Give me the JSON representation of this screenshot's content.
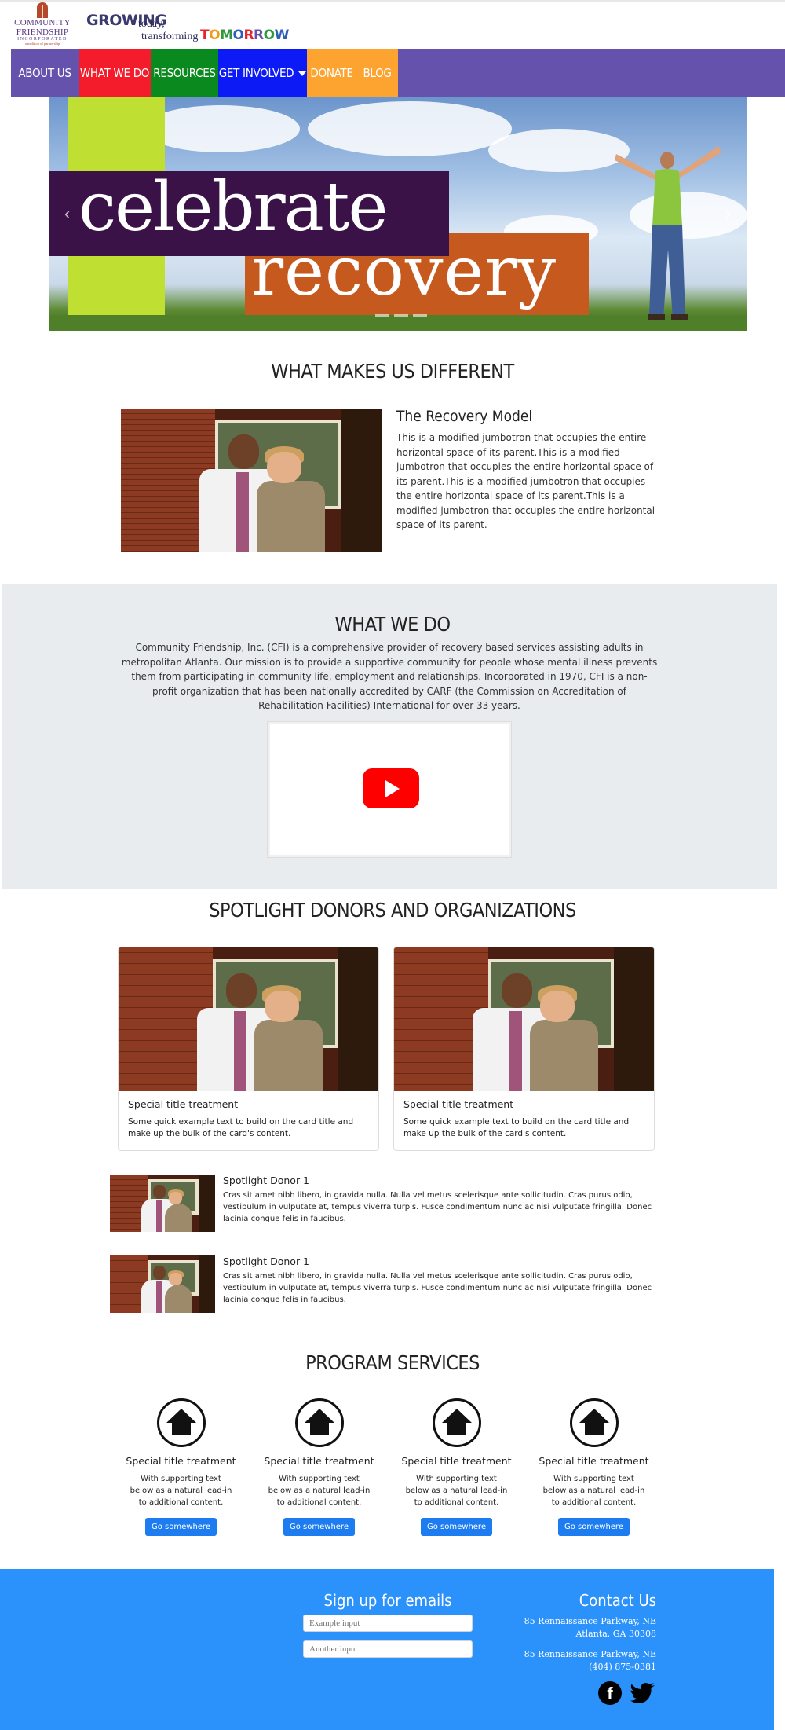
{
  "header": {
    "logo": {
      "line1": "COMMUNITY",
      "line2": "FRIENDSHIP",
      "line3": "INCORPORATED",
      "line4": "a tradition of partnership"
    },
    "tagline": {
      "growing": "GROWING",
      "today": "today,",
      "transforming": "transforming",
      "tomorrow": "TOMORROW"
    }
  },
  "nav": {
    "items": [
      {
        "label": "ABOUT US",
        "color": "#6452ad"
      },
      {
        "label": "WHAT WE DO",
        "color": "#f41c2b"
      },
      {
        "label": "RESOURCES",
        "color": "#0a8a1e"
      },
      {
        "label": "GET INVOLVED",
        "color": "#0c1bf6"
      },
      {
        "label": "DONATE",
        "color": "#fca330"
      },
      {
        "label": "BLOG",
        "color": "#fca330"
      }
    ]
  },
  "hero": {
    "word1": "celebrate",
    "word2": "recovery",
    "prev": "‹",
    "next": "›"
  },
  "different": {
    "heading": "WHAT MAKES US DIFFERENT",
    "title": "The Recovery Model",
    "text": "This is a modified jumbotron that occupies the entire horizontal space of its parent.This is a modified jumbotron that occupies the entire horizontal space of its parent.This is a modified jumbotron that occupies the entire horizontal space of its parent.This is a modified jumbotron that occupies the entire horizontal space of its parent."
  },
  "what_we_do": {
    "heading": "WHAT WE DO",
    "text": "Community Friendship, Inc. (CFI) is a comprehensive provider of recovery based services assisting adults in metropolitan Atlanta. Our mission is to provide a supportive community for people whose mental illness prevents them from participating in community life, employment and relationships. Incorporated in 1970, CFI is a non-profit organization that has been nationally accredited by CARF (the Commission on Accreditation of Rehabilitation Facilities) International for over 33 years."
  },
  "spotlight": {
    "heading": "SPOTLIGHT DONORS AND ORGANIZATIONS",
    "cards": [
      {
        "title": "Special title treatment",
        "text": "Some quick example text to build on the card title and make up the bulk of the card's content."
      },
      {
        "title": "Special title treatment",
        "text": "Some quick example text to build on the card title and make up the bulk of the card's content."
      }
    ],
    "donors": [
      {
        "title": "Spotlight Donor 1",
        "text": "Cras sit amet nibh libero, in gravida nulla. Nulla vel metus scelerisque ante sollicitudin. Cras purus odio, vestibulum in vulputate at, tempus viverra turpis. Fusce condimentum nunc ac nisi vulputate fringilla. Donec lacinia congue felis in faucibus."
      },
      {
        "title": "Spotlight Donor 1",
        "text": "Cras sit amet nibh libero, in gravida nulla. Nulla vel metus scelerisque ante sollicitudin. Cras purus odio, vestibulum in vulputate at, tempus viverra turpis. Fusce condimentum nunc ac nisi vulputate fringilla. Donec lacinia congue felis in faucibus."
      }
    ]
  },
  "services": {
    "heading": "PROGRAM SERVICES",
    "items": [
      {
        "icon": "home-icon",
        "title": "Special title treatment",
        "text": "With supporting text below as a natural lead-in to additional content.",
        "button": "Go somewhere"
      },
      {
        "icon": "home-icon",
        "title": "Special title treatment",
        "text": "With supporting text below as a natural lead-in to additional content.",
        "button": "Go somewhere"
      },
      {
        "icon": "home-icon",
        "title": "Special title treatment",
        "text": "With supporting text below as a natural lead-in to additional content.",
        "button": "Go somewhere"
      },
      {
        "icon": "home-icon",
        "title": "Special title treatment",
        "text": "With supporting text below as a natural lead-in to additional content.",
        "button": "Go somewhere"
      }
    ]
  },
  "footer": {
    "signup_heading": "Sign up for emails",
    "input1_placeholder": "Example input",
    "input2_placeholder": "Another input",
    "contact_heading": "Contact Us",
    "address1_line1": "85 Rennaissance Parkway, NE",
    "address1_line2": "Atlanta, GA 30308",
    "address2_line1": "85 Rennaissance Parkway, NE",
    "address2_line2": "(404) 875-0381",
    "social": [
      "facebook-icon",
      "twitter-icon"
    ],
    "bg_color": "#2b91fb"
  }
}
